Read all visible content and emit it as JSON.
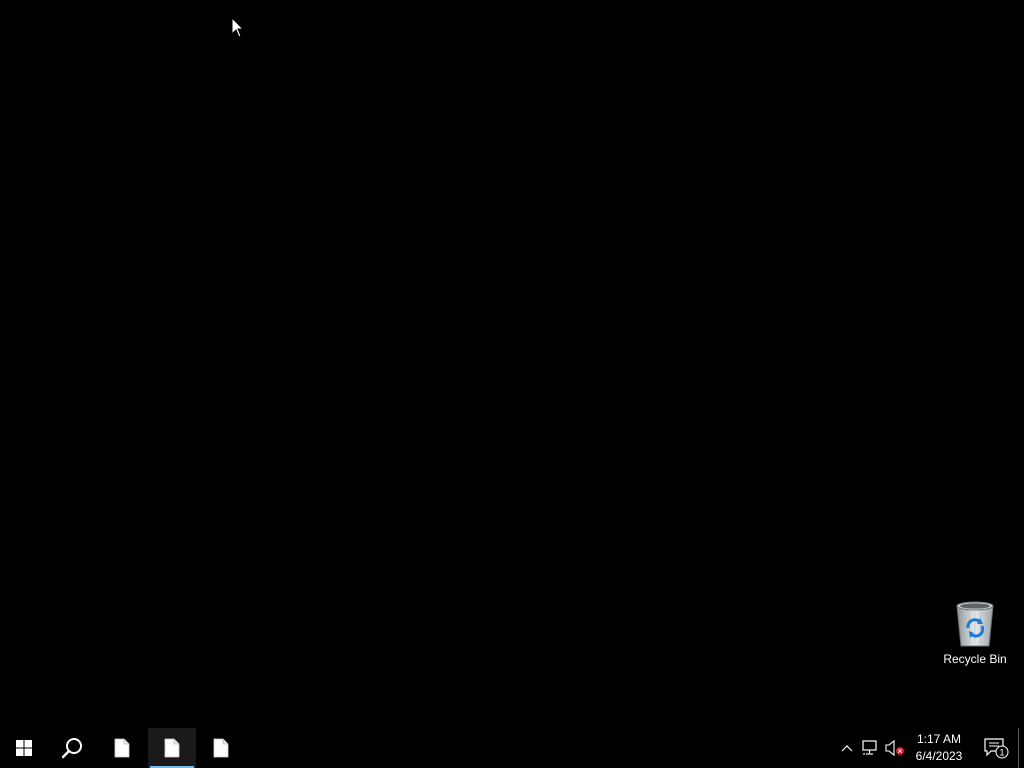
{
  "desktop": {
    "icons": [
      {
        "label": "Recycle Bin",
        "icon": "recycle-bin-icon"
      }
    ]
  },
  "taskbar": {
    "start_icon": "windows-logo-icon",
    "search_icon": "search-icon",
    "apps": [
      {
        "icon": "document-icon",
        "state": "running"
      },
      {
        "icon": "document-icon",
        "state": "active"
      },
      {
        "icon": "document-icon",
        "state": "running"
      }
    ],
    "tray": {
      "chevron_icon": "chevron-up-icon",
      "network_icon": "network-icon",
      "volume_icon": "volume-muted-icon",
      "time": "1:17 AM",
      "date": "6/4/2023",
      "notification_icon": "notification-icon",
      "notification_count": "1"
    },
    "accent_color": "#76b9ed"
  }
}
